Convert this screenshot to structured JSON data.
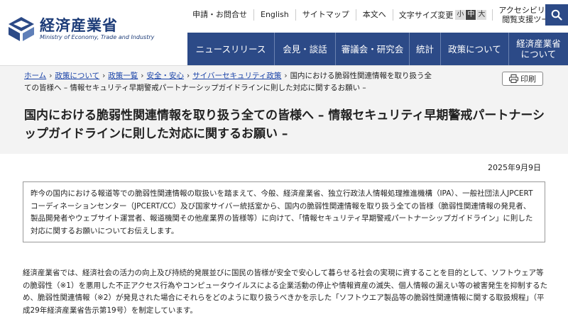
{
  "header": {
    "logo_jp": "経済産業省",
    "logo_en": "Ministry of Economy, Trade and Industry",
    "utility": [
      "申請・お問合せ",
      "English",
      "サイトマップ",
      "本文へ"
    ],
    "text_size_label": "文字サイズ変更",
    "text_size_options": [
      "小",
      "中",
      "大"
    ],
    "text_size_selected": "中",
    "accessibility_line1": "アクセシビリティ",
    "accessibility_line2": "閲覧支援ツール",
    "search_icon": "search-icon",
    "nav": [
      "ニュースリリース",
      "会見・談話",
      "審議会・研究会",
      "統計",
      "政策について",
      "経済産業省について"
    ]
  },
  "breadcrumb": {
    "items": [
      "ホーム",
      "政策について",
      "政策一覧",
      "安全・安心",
      "サイバーセキュリティ政策"
    ],
    "current": "国内における脆弱性関連情報を取り扱う全ての皆様へ – 情報セキュリティ早期警戒パートナーシップガイドラインに則した対応に関するお願い –",
    "separator": "›"
  },
  "print_label": "印刷",
  "page_title": "国内における脆弱性関連情報を取り扱う全ての皆様へ – 情報セキュリティ早期警戒パートナーシップガイドラインに則した対応に関するお願い –",
  "date": "2025年9月9日",
  "lead": "昨今の国内における報道等での脆弱性関連情報の取扱いを踏まえて、今般、経済産業省、独立行政法人情報処理推進機構（IPA）、一般社団法人JPCERTコーディネーションセンター（JPCERT/CC）及び国家サイバー統括室から、国内の脆弱性関連情報を取り扱う全ての皆様（脆弱性関連情報の発見者、製品開発者やウェブサイト運営者、報道機関その他産業界の皆様等）に向けて、「情報セキュリティ早期警戒パートナーシップガイドライン」に則した対応に関するお願いについてお伝えします。",
  "body": "経済産業省では、経済社会の活力の向上及び持続的発展並びに国民の皆様が安全で安心して暮らせる社会の実現に資することを目的として、ソフトウェア等の脆弱性（※1）を悪用した不正アクセス行為やコンピュータウイルスによる企業活動の停止や情報資産の滅失、個人情報の漏えい等の被害発生を抑制するため、脆弱性関連情報（※2）が発見された場合にそれらをどのように取り扱うべきかを示した「ソフトウエア製品等の脆弱性関連情報に関する取扱規程」（平成29年経済産業省告示第19号）を制定しています。",
  "colors": {
    "navy": "#2c4a87",
    "link": "#1a43a8",
    "band": "#f3f3f3"
  }
}
